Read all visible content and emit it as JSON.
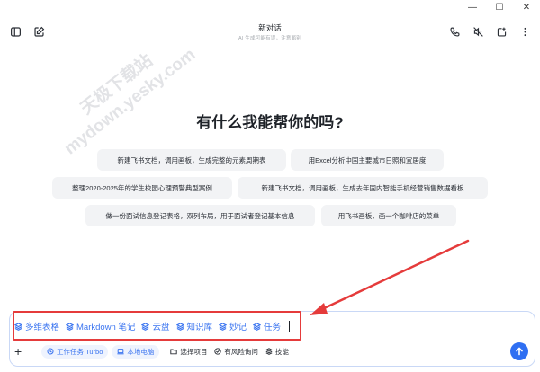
{
  "window": {
    "minimize": "—",
    "maximize": "☐",
    "close": "✕"
  },
  "header": {
    "title": "新对话",
    "subtitle": "AI 生成可能有误，注意甄别",
    "left_icons": [
      "sidebar-icon",
      "new-chat-icon"
    ],
    "right_icons": [
      "phone-icon",
      "mute-icon",
      "new-window-icon",
      "more-icon"
    ]
  },
  "watermark": {
    "line1": "天极下载站",
    "line2": "mydown.yesky.com"
  },
  "main": {
    "heading": "有什么我能帮你的吗?",
    "suggestions": [
      {
        "text": "新建飞书文档，调用画板，生成完整的元素周期表"
      },
      {
        "text": "用Excel分析中国主要城市日照和宜居度"
      },
      {
        "text": "整理2020-2025年的学生校园心理预警典型案例"
      },
      {
        "text": "新建飞书文档，调用画板，生成去年国内智能手机经营销售数据看板"
      },
      {
        "text": "做一份面试信息登记表格，双列布局，用于面试者登记基本信息"
      },
      {
        "text": "用飞书画板，画一个咖啡店的菜单"
      }
    ]
  },
  "input": {
    "tags": [
      "多维表格",
      "Markdown 笔记",
      "云盘",
      "知识库",
      "妙记",
      "任务"
    ],
    "accent_color": "#3a74f0",
    "annotation_color": "#e53b3b"
  },
  "toolbar": {
    "plus": "+",
    "mode_pill": "工作任务 Turbo",
    "location_pill": "本地电脑",
    "select_project": "选择项目",
    "risk_ask": "有风险询问",
    "skills": "技能",
    "send_color": "#2f6ff2"
  }
}
